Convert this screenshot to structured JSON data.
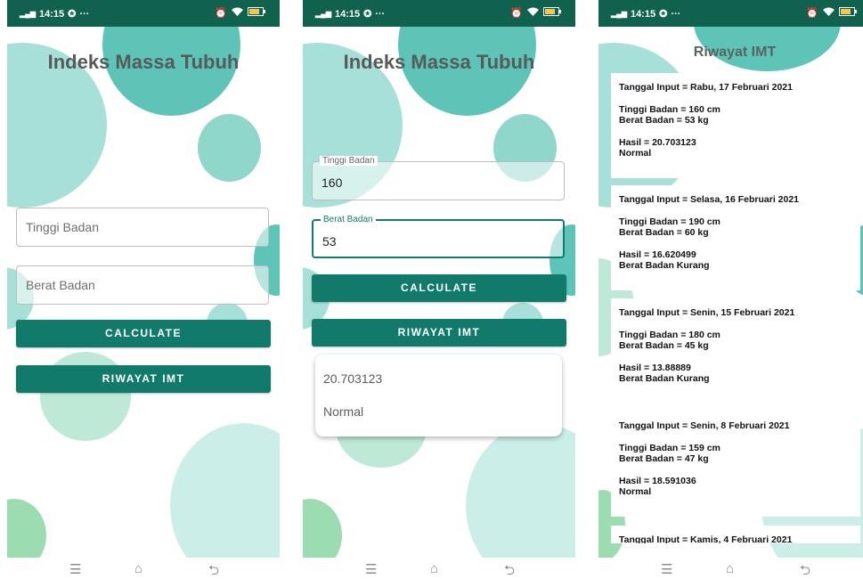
{
  "status": {
    "time": "14:15",
    "network": "4G 4G"
  },
  "screen1": {
    "title": "Indeks Massa Tubuh",
    "height_placeholder": "Tinggi Badan",
    "weight_placeholder": "Berat Badan",
    "calculate_label": "CALCULATE",
    "history_label": "RIWAYAT IMT"
  },
  "screen2": {
    "title": "Indeks Massa Tubuh",
    "height_label": "Tinggi Badan",
    "height_value": "160",
    "weight_label": "Berat Badan",
    "weight_value": "53",
    "calculate_label": "CALCULATE",
    "history_label": "RIWAYAT IMT",
    "result_value": "20.703123",
    "result_category": "Normal"
  },
  "screen3": {
    "title": "Riwayat IMT",
    "entries": [
      {
        "date": "Tanggal Input = Rabu, 17 Februari 2021",
        "height": "Tinggi Badan = 160 cm",
        "weight": "Berat Badan = 53 kg",
        "result": "Hasil = 20.703123",
        "category": "Normal"
      },
      {
        "date": "Tanggal Input = Selasa, 16 Februari 2021",
        "height": "Tinggi Badan = 190 cm",
        "weight": "Berat Badan = 60 kg",
        "result": "Hasil = 16.620499",
        "category": "Berat Badan Kurang"
      },
      {
        "date": "Tanggal Input = Senin, 15 Februari 2021",
        "height": "Tinggi Badan = 180 cm",
        "weight": "Berat Badan = 45 kg",
        "result": "Hasil = 13.88889",
        "category": "Berat Badan Kurang"
      },
      {
        "date": "Tanggal Input = Senin, 8 Februari 2021",
        "height": "Tinggi Badan = 159 cm",
        "weight": "Berat Badan = 47 kg",
        "result": "Hasil = 18.591036",
        "category": "Normal"
      },
      {
        "date": "Tanggal Input = Kamis, 4 Februari 2021"
      }
    ]
  },
  "icons": {
    "alarm": "alarm-icon",
    "wifi": "wifi-icon",
    "battery": "battery-icon",
    "menu": "menu-icon",
    "home": "home-icon",
    "back": "back-icon"
  },
  "colors": {
    "status_bar": "#11614f",
    "button": "#117a6b",
    "blob_teal": "#5fc4b8",
    "blob_light": "#a6e0d8",
    "blob_green": "#9bdcb0"
  }
}
